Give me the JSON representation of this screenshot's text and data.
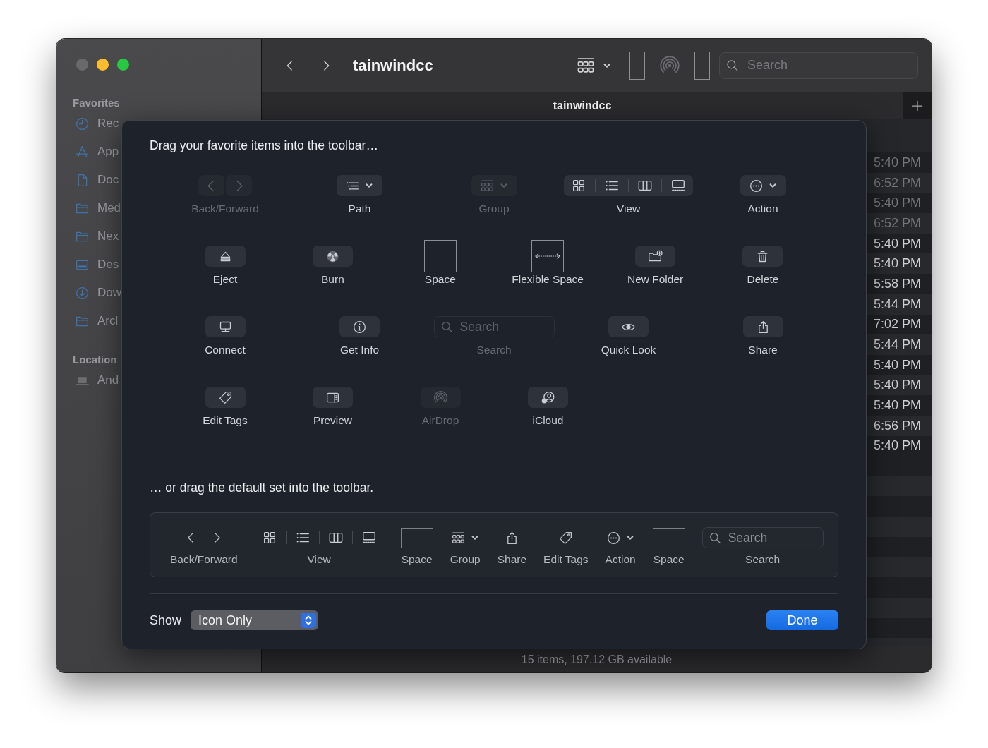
{
  "window_controls": [
    {
      "color": "#69696c"
    },
    {
      "color": "#febc2e"
    },
    {
      "color": "#28c840"
    }
  ],
  "sidebar": {
    "sections": [
      {
        "title": "Favorites",
        "items": [
          {
            "label": "Rec",
            "kind": "recents"
          },
          {
            "label": "App",
            "kind": "applications"
          },
          {
            "label": "Doc",
            "kind": "document"
          },
          {
            "label": "Med",
            "kind": "folder"
          },
          {
            "label": "Nex",
            "kind": "folder"
          },
          {
            "label": "Des",
            "kind": "desktop"
          },
          {
            "label": "Dow",
            "kind": "downloads"
          },
          {
            "label": "Arcl",
            "kind": "folder"
          }
        ]
      },
      {
        "title": "Location",
        "items": [
          {
            "label": "And",
            "kind": "computer"
          }
        ]
      }
    ]
  },
  "toolbar": {
    "title": "tainwindcc",
    "items": [
      {
        "kind": "group"
      },
      {
        "kind": "space"
      },
      {
        "kind": "airdrop"
      },
      {
        "kind": "space"
      },
      {
        "kind": "search",
        "placeholder": "Search"
      }
    ]
  },
  "tab": {
    "label": "tainwindcc"
  },
  "file_list": {
    "rows": [
      {
        "time": "5:40 PM",
        "hidden": true
      },
      {
        "time": "6:52 PM",
        "hidden": true
      },
      {
        "time": "5:40 PM",
        "hidden": true
      },
      {
        "time": "6:52 PM",
        "hidden": true
      },
      {
        "time": "5:40 PM",
        "hidden": false
      },
      {
        "time": "5:40 PM",
        "hidden": false
      },
      {
        "time": "5:58 PM",
        "hidden": false
      },
      {
        "time": "5:44 PM",
        "hidden": false
      },
      {
        "time": "7:02 PM",
        "hidden": false
      },
      {
        "time": "5:44 PM",
        "hidden": false
      },
      {
        "time": "5:40 PM",
        "hidden": false
      },
      {
        "time": "5:40 PM",
        "hidden": false
      },
      {
        "time": "5:40 PM",
        "hidden": false
      },
      {
        "time": "6:56 PM",
        "hidden": false
      },
      {
        "time": "5:40 PM",
        "hidden": false
      }
    ]
  },
  "status_bar": {
    "text": "15 items, 197.12 GB available"
  },
  "customize_sheet": {
    "title": "Drag your favorite items into the toolbar…",
    "palette_rows": [
      {
        "items": [
          {
            "label": "Back/Forward",
            "kind": "back-forward",
            "disabled": true
          },
          {
            "label": "Path",
            "kind": "path",
            "disabled": false
          },
          {
            "label": "Group",
            "kind": "group",
            "disabled": true
          },
          {
            "label": "View",
            "kind": "view",
            "disabled": false
          },
          {
            "label": "Action",
            "kind": "action",
            "disabled": false
          }
        ]
      },
      {
        "items": [
          {
            "label": "Eject",
            "kind": "eject",
            "disabled": false
          },
          {
            "label": "Burn",
            "kind": "burn",
            "disabled": false
          },
          {
            "label": "Space",
            "kind": "space",
            "disabled": false
          },
          {
            "label": "Flexible Space",
            "kind": "flexible-space",
            "disabled": false
          },
          {
            "label": "New Folder",
            "kind": "new-folder",
            "disabled": false
          },
          {
            "label": "Delete",
            "kind": "delete",
            "disabled": false
          }
        ]
      },
      {
        "items": [
          {
            "label": "Connect",
            "kind": "connect",
            "disabled": false
          },
          {
            "label": "Get Info",
            "kind": "info",
            "disabled": false
          },
          {
            "label": "Search",
            "kind": "search",
            "placeholder": "Search",
            "disabled": true
          },
          {
            "label": "Quick Look",
            "kind": "quick-look",
            "disabled": false
          },
          {
            "label": "Share",
            "kind": "share",
            "disabled": false
          }
        ]
      },
      {
        "items": [
          {
            "label": "Edit Tags",
            "kind": "tags",
            "disabled": false
          },
          {
            "label": "Preview",
            "kind": "preview",
            "disabled": false
          },
          {
            "label": "AirDrop",
            "kind": "airdrop",
            "disabled": true
          },
          {
            "label": "iCloud",
            "kind": "icloud",
            "disabled": false
          }
        ]
      }
    ],
    "default_set_title": "… or drag the default set into the toolbar.",
    "default_set": [
      {
        "label": "Back/Forward",
        "kind": "back-forward"
      },
      {
        "label": "View",
        "kind": "view"
      },
      {
        "label": "Space",
        "kind": "space"
      },
      {
        "label": "Group",
        "kind": "group"
      },
      {
        "label": "Share",
        "kind": "share"
      },
      {
        "label": "Edit Tags",
        "kind": "tags"
      },
      {
        "label": "Action",
        "kind": "action"
      },
      {
        "label": "Space",
        "kind": "space"
      },
      {
        "label": "Search",
        "kind": "search",
        "placeholder": "Search"
      }
    ],
    "show_label": "Show",
    "show_popup": {
      "value": "Icon Only"
    },
    "done_button": "Done"
  }
}
